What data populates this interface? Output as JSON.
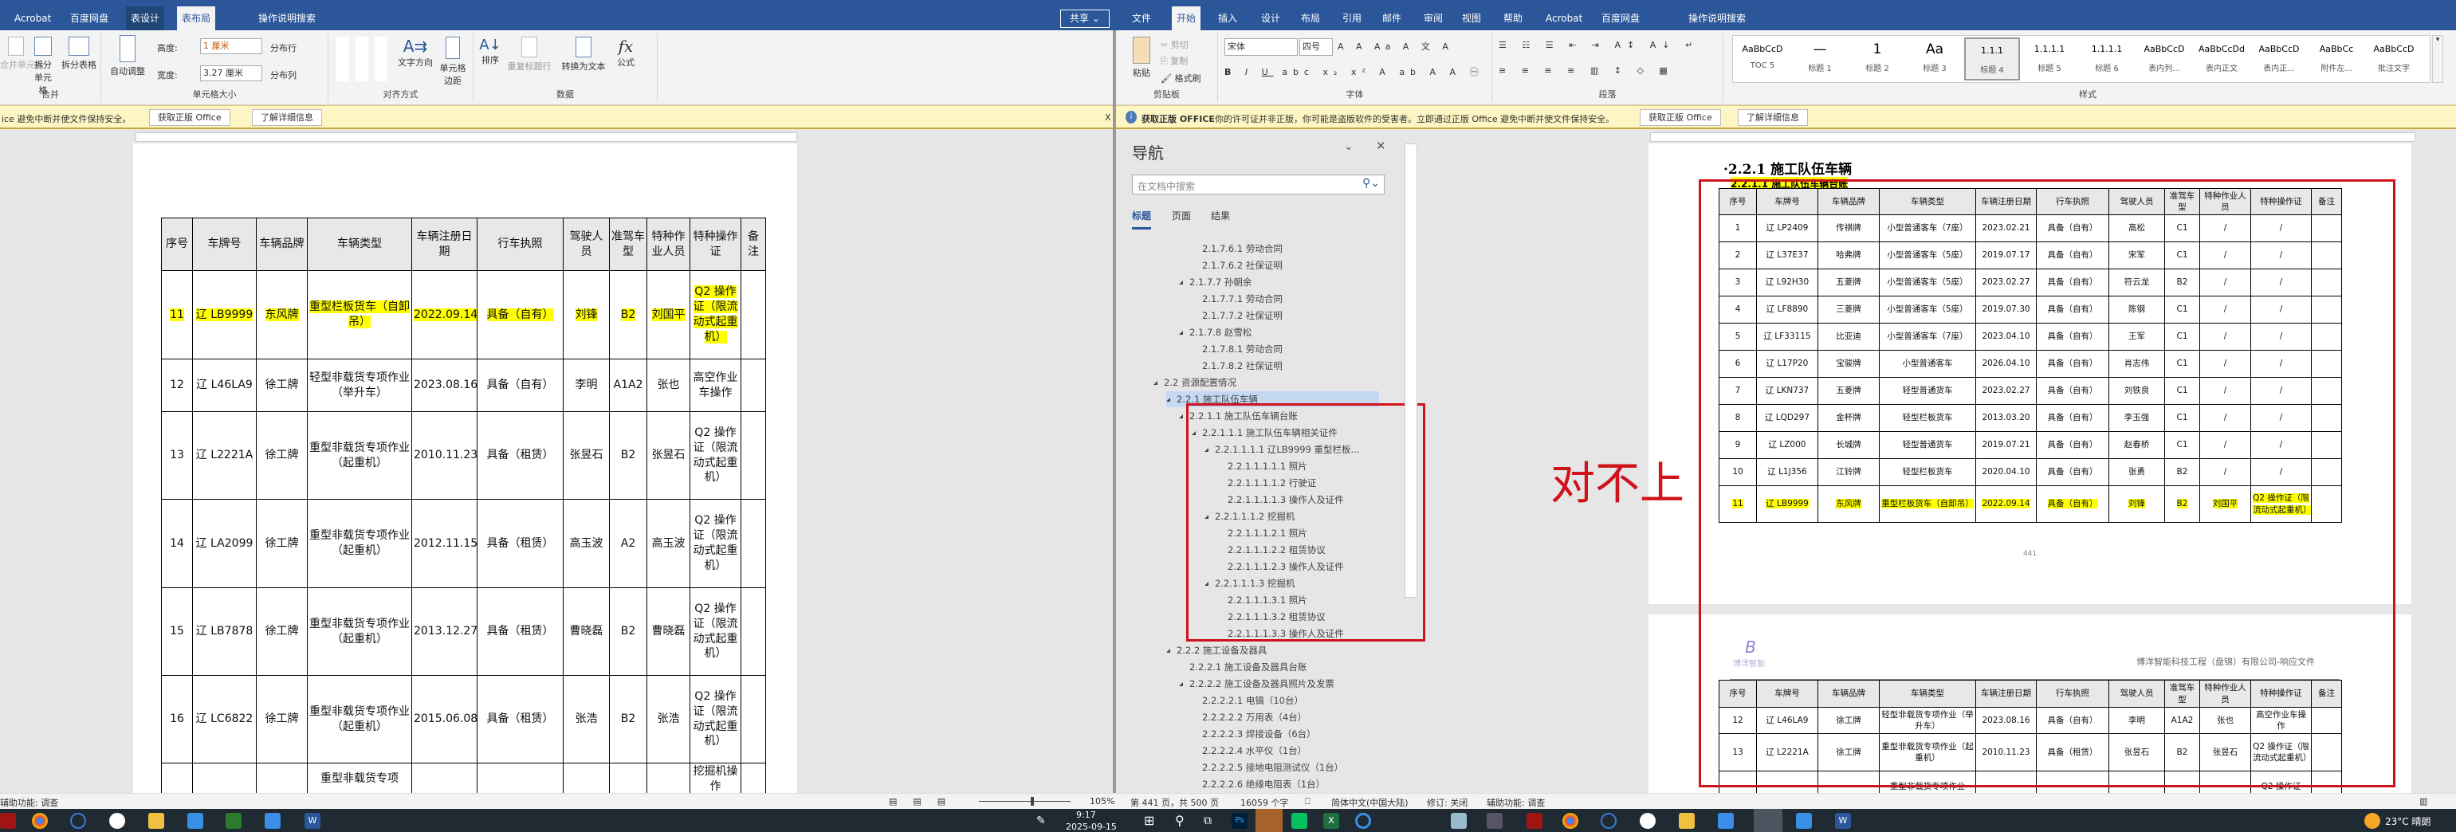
{
  "left_window": {
    "tabs": [
      {
        "label": "Acrobat"
      },
      {
        "label": "百度网盘"
      },
      {
        "label": "表设计"
      },
      {
        "label": "表布局"
      },
      {
        "label": "操作说明搜索"
      }
    ],
    "share_label": "共享",
    "ribbon": {
      "merge": {
        "label": "合并",
        "items": [
          "合并单元格",
          "拆分单元格",
          "拆分表格"
        ]
      },
      "cell_size": {
        "label": "单元格大小",
        "autofit": "自动调整",
        "height_label": "高度:",
        "height_value": "1 厘米",
        "width_label": "宽度:",
        "width_value": "3.27 厘米",
        "dist_rows": "分布行",
        "dist_cols": "分布列"
      },
      "align": {
        "label": "对齐方式",
        "text_dir": "文字方向",
        "cell_margin": "单元格边距"
      },
      "data": {
        "label": "数据",
        "sort": "排序",
        "repeat_header": "重复标题行",
        "convert": "转换为文本",
        "formula": "公式"
      }
    },
    "msgbar": {
      "text": "ice 避免中断并使文件保持安全。",
      "btn1": "获取正版 Office",
      "btn2": "了解详细信息",
      "close": "X"
    },
    "table": {
      "headers": [
        "序号",
        "车牌号",
        "车辆品牌",
        "车辆类型",
        "车辆注册日期",
        "行车执照",
        "驾驶人员",
        "准驾车型",
        "特种作业人员",
        "特种操作证",
        "备注"
      ],
      "rows": [
        {
          "highlight": true,
          "cells": [
            "11",
            "辽 LB9999",
            "东风牌",
            "重型栏板货车（自卸吊）",
            "2022.09.14",
            "具备（自有）",
            "刘锋",
            "B2",
            "刘国平",
            "Q2 操作证（限流动式起重机）",
            ""
          ]
        },
        {
          "highlight": false,
          "cells": [
            "12",
            "辽 L46LA9",
            "徐工牌",
            "轻型非载货专项作业（举升车）",
            "2023.08.16",
            "具备（自有）",
            "李明",
            "A1A2",
            "张也",
            "高空作业车操作",
            ""
          ]
        },
        {
          "highlight": false,
          "cells": [
            "13",
            "辽 L2221A",
            "徐工牌",
            "重型非载货专项作业（起重机）",
            "2010.11.23",
            "具备（租赁）",
            "张昱石",
            "B2",
            "张昱石",
            "Q2 操作证（限流动式起重机）",
            ""
          ]
        },
        {
          "highlight": false,
          "cells": [
            "14",
            "辽 LA2099",
            "徐工牌",
            "重型非载货专项作业（起重机）",
            "2012.11.15",
            "具备（租赁）",
            "高玉波",
            "A2",
            "高玉波",
            "Q2 操作证（限流动式起重机）",
            ""
          ]
        },
        {
          "highlight": false,
          "cells": [
            "15",
            "辽 LB7878",
            "徐工牌",
            "重型非载货专项作业（起重机）",
            "2013.12.27",
            "具备（租赁）",
            "曹晓磊",
            "B2",
            "曹晓磊",
            "Q2 操作证（限流动式起重机）",
            ""
          ]
        },
        {
          "highlight": false,
          "cells": [
            "16",
            "辽 LC6822",
            "徐工牌",
            "重型非载货专项作业（起重机）",
            "2015.06.08",
            "具备（租赁）",
            "张浩",
            "B2",
            "张浩",
            "Q2 操作证（限流动式起重机）",
            ""
          ]
        },
        {
          "highlight": false,
          "cells": [
            "",
            "",
            "",
            "重型非载货专项",
            "",
            "",
            "",
            "",
            "",
            "挖掘机操作",
            ""
          ]
        }
      ]
    },
    "status": {
      "accessibility": "辅助功能: 调查",
      "zoom": "105%"
    }
  },
  "right_window": {
    "tabs": [
      {
        "label": "文件"
      },
      {
        "label": "开始"
      },
      {
        "label": "插入"
      },
      {
        "label": "设计"
      },
      {
        "label": "布局"
      },
      {
        "label": "引用"
      },
      {
        "label": "邮件"
      },
      {
        "label": "审阅"
      },
      {
        "label": "视图"
      },
      {
        "label": "帮助"
      },
      {
        "label": "Acrobat"
      },
      {
        "label": "百度网盘"
      },
      {
        "label": "操作说明搜索"
      }
    ],
    "ribbon": {
      "clipboard": {
        "label": "剪贴板",
        "paste": "粘贴",
        "cut": "剪切",
        "copy": "复制",
        "format_painter": "格式刷"
      },
      "font": {
        "label": "字体",
        "font_name": "宋体",
        "font_size": "四号"
      },
      "paragraph": {
        "label": "段落"
      },
      "styles": {
        "label": "样式",
        "items": [
          {
            "preview": "AaBbCcD",
            "name": "TOC 5"
          },
          {
            "preview": "—",
            "name": "标题 1"
          },
          {
            "preview": "1",
            "name": "标题 2"
          },
          {
            "preview": "Aa",
            "name": "标题 3"
          },
          {
            "preview": "1.1.1",
            "name": "标题 4"
          },
          {
            "preview": "1.1.1.1",
            "name": "标题 5"
          },
          {
            "preview": "1.1.1.1",
            "name": "标题 6"
          },
          {
            "preview": "AaBbCcD",
            "name": "表内列..."
          },
          {
            "preview": "AaBbCcDd",
            "name": "表内正文"
          },
          {
            "preview": "AaBbCcD",
            "name": "表内正..."
          },
          {
            "preview": "AaBbCc",
            "name": "附件左..."
          },
          {
            "preview": "AaBbCcD",
            "name": "批注文字"
          }
        ]
      }
    },
    "msgbar": {
      "title": "获取正版 OFFICE",
      "text": "你的许可证并非正版，你可能是盗版软件的受害者。立即通过正版 Office 避免中断并使文件保持安全。",
      "btn1": "获取正版 Office",
      "btn2": "了解详细信息"
    },
    "nav": {
      "title": "导航",
      "search_placeholder": "在文档中搜索",
      "tabs": [
        "标题",
        "页面",
        "结果"
      ],
      "items": [
        {
          "level": 4,
          "text": "2.1.7.6.1 劳动合同",
          "exp": false
        },
        {
          "level": 4,
          "text": "2.1.7.6.2 社保证明",
          "exp": false
        },
        {
          "level": 3,
          "text": "2.1.7.7 孙朝余",
          "exp": true
        },
        {
          "level": 4,
          "text": "2.1.7.7.1 劳动合同",
          "exp": false
        },
        {
          "level": 4,
          "text": "2.1.7.7.2 社保证明",
          "exp": false
        },
        {
          "level": 3,
          "text": "2.1.7.8 赵雪松",
          "exp": true
        },
        {
          "level": 4,
          "text": "2.1.7.8.1 劳动合同",
          "exp": false
        },
        {
          "level": 4,
          "text": "2.1.7.8.2 社保证明",
          "exp": false
        },
        {
          "level": 1,
          "text": "2.2 资源配置情况",
          "exp": true
        },
        {
          "level": 2,
          "text": "2.2.1 施工队伍车辆",
          "exp": true,
          "selected": true
        },
        {
          "level": 3,
          "text": "2.2.1.1 施工队伍车辆台账",
          "exp": true
        },
        {
          "level": 4,
          "text": "2.2.1.1.1 施工队伍车辆相关证件",
          "exp": true
        },
        {
          "level": 5,
          "text": "2.2.1.1.1.1 辽LB9999 重型栏板...",
          "exp": true
        },
        {
          "level": 6,
          "text": "2.2.1.1.1.1.1 照片",
          "exp": false
        },
        {
          "level": 6,
          "text": "2.2.1.1.1.1.2 行驶证",
          "exp": false
        },
        {
          "level": 6,
          "text": "2.2.1.1.1.1.3 操作人及证件",
          "exp": false
        },
        {
          "level": 5,
          "text": "2.2.1.1.1.2 挖掘机",
          "exp": true
        },
        {
          "level": 6,
          "text": "2.2.1.1.1.2.1 照片",
          "exp": false
        },
        {
          "level": 6,
          "text": "2.2.1.1.1.2.2 租赁协议",
          "exp": false
        },
        {
          "level": 6,
          "text": "2.2.1.1.1.2.3 操作人及证件",
          "exp": false
        },
        {
          "level": 5,
          "text": "2.2.1.1.1.3 挖掘机",
          "exp": true
        },
        {
          "level": 6,
          "text": "2.2.1.1.1.3.1 照片",
          "exp": false
        },
        {
          "level": 6,
          "text": "2.2.1.1.1.3.2 租赁协议",
          "exp": false
        },
        {
          "level": 6,
          "text": "2.2.1.1.1.3.3 操作人及证件",
          "exp": false
        },
        {
          "level": 2,
          "text": "2.2.2 施工设备及器具",
          "exp": true
        },
        {
          "level": 3,
          "text": "2.2.2.1 施工设备及器具台账",
          "exp": false
        },
        {
          "level": 3,
          "text": "2.2.2.2 施工设备及器具照片及发票",
          "exp": true
        },
        {
          "level": 4,
          "text": "2.2.2.2.1 电镐（10台）",
          "exp": false
        },
        {
          "level": 4,
          "text": "2.2.2.2.2 万用表（4台）",
          "exp": false
        },
        {
          "level": 4,
          "text": "2.2.2.2.3 焊接设备（6台）",
          "exp": false
        },
        {
          "level": 4,
          "text": "2.2.2.2.4 水平仪（1台）",
          "exp": false
        },
        {
          "level": 4,
          "text": "2.2.2.2.5 接地电阻测试仪（1台）",
          "exp": false
        },
        {
          "level": 4,
          "text": "2.2.2.2.6 绝缘电阻表（1台）",
          "exp": false
        }
      ]
    },
    "doc": {
      "heading": "·2.2.1 施工队伍车辆",
      "subheading": "2.2.1.1 施工队伍车辆台账",
      "page_number": "441",
      "header_company": "博洋智能科技工程（盘锦）有限公司-响应文件",
      "logo_text": "博洋智能",
      "annotation": "对不上",
      "table1_rows": [
        {
          "highlight": false,
          "cells": [
            "1",
            "辽 LP2409",
            "传祺牌",
            "小型普通客车（7座）",
            "2023.02.21",
            "具备（自有）",
            "高松",
            "C1",
            "/",
            "/",
            ""
          ]
        },
        {
          "highlight": false,
          "cells": [
            "2",
            "辽 L37E37",
            "哈弗牌",
            "小型普通客车（5座）",
            "2019.07.17",
            "具备（自有）",
            "宋军",
            "C1",
            "/",
            "/",
            ""
          ]
        },
        {
          "highlight": false,
          "cells": [
            "3",
            "辽 L92H30",
            "五菱牌",
            "小型普通客车（5座）",
            "2023.02.27",
            "具备（自有）",
            "符云龙",
            "B2",
            "/",
            "/",
            ""
          ]
        },
        {
          "highlight": false,
          "cells": [
            "4",
            "辽 LF8890",
            "三菱牌",
            "小型普通客车（5座）",
            "2019.07.30",
            "具备（自有）",
            "陈钢",
            "C1",
            "/",
            "/",
            ""
          ]
        },
        {
          "highlight": false,
          "cells": [
            "5",
            "辽 LF33115",
            "比亚迪",
            "小型普通客车（7座）",
            "2023.04.10",
            "具备（自有）",
            "王军",
            "C1",
            "/",
            "/",
            ""
          ]
        },
        {
          "highlight": false,
          "cells": [
            "6",
            "辽 L17P20",
            "宝骏牌",
            "小型普通客车",
            "2026.04.10",
            "具备（自有）",
            "肖志伟",
            "C1",
            "/",
            "/",
            ""
          ]
        },
        {
          "highlight": false,
          "cells": [
            "7",
            "辽 LKN737",
            "五菱牌",
            "轻型普通货车",
            "2023.02.27",
            "具备（自有）",
            "刘铁良",
            "C1",
            "/",
            "/",
            ""
          ]
        },
        {
          "highlight": false,
          "cells": [
            "8",
            "辽 LQD297",
            "金杯牌",
            "轻型栏板货车",
            "2013.03.20",
            "具备（自有）",
            "李玉强",
            "C1",
            "/",
            "/",
            ""
          ]
        },
        {
          "highlight": false,
          "cells": [
            "9",
            "辽 LZ000",
            "长城牌",
            "轻型普通货车",
            "2019.07.21",
            "具备（自有）",
            "赵春桥",
            "C1",
            "/",
            "/",
            ""
          ]
        },
        {
          "highlight": false,
          "cells": [
            "10",
            "辽 L1J356",
            "江铃牌",
            "轻型栏板货车",
            "2020.04.10",
            "具备（自有）",
            "张勇",
            "B2",
            "/",
            "/",
            ""
          ]
        },
        {
          "highlight": true,
          "cells": [
            "11",
            "辽 LB9999",
            "东风牌",
            "重型栏板货车（自卸吊）",
            "2022.09.14",
            "具备（自有）",
            "刘锋",
            "B2",
            "刘国平",
            "Q2 操作证（限流动式起重机）",
            ""
          ]
        }
      ],
      "table2_rows": [
        {
          "highlight": false,
          "cells": [
            "12",
            "辽 L46LA9",
            "徐工牌",
            "轻型非载货专项作业（举升车）",
            "2023.08.16",
            "具备（自有）",
            "李明",
            "A1A2",
            "张也",
            "高空作业车操作",
            ""
          ]
        },
        {
          "highlight": false,
          "cells": [
            "13",
            "辽 L2221A",
            "徐工牌",
            "重型非载货专项作业（起重机）",
            "2010.11.23",
            "具备（租赁）",
            "张昱石",
            "B2",
            "张昱石",
            "Q2 操作证（限流动式起重机）",
            ""
          ]
        },
        {
          "highlight": false,
          "cells": [
            "",
            "",
            "",
            "重型非载货专项作业",
            "",
            "",
            "",
            "",
            "",
            "Q2 操作证",
            ""
          ]
        }
      ]
    },
    "status": {
      "page": "第 441 页，共 500 页",
      "words": "16059 个字",
      "language": "简体中文(中国大陆)",
      "track": "修订: 关闭",
      "accessibility": "辅助功能: 调查"
    }
  },
  "taskbar": {
    "time": "9:17",
    "date": "2025-09-15",
    "weather": "23°C 晴朗"
  },
  "colors": {
    "accent": "#2b579a",
    "highlight": "#ffff00",
    "annotation": "#d0121b"
  }
}
